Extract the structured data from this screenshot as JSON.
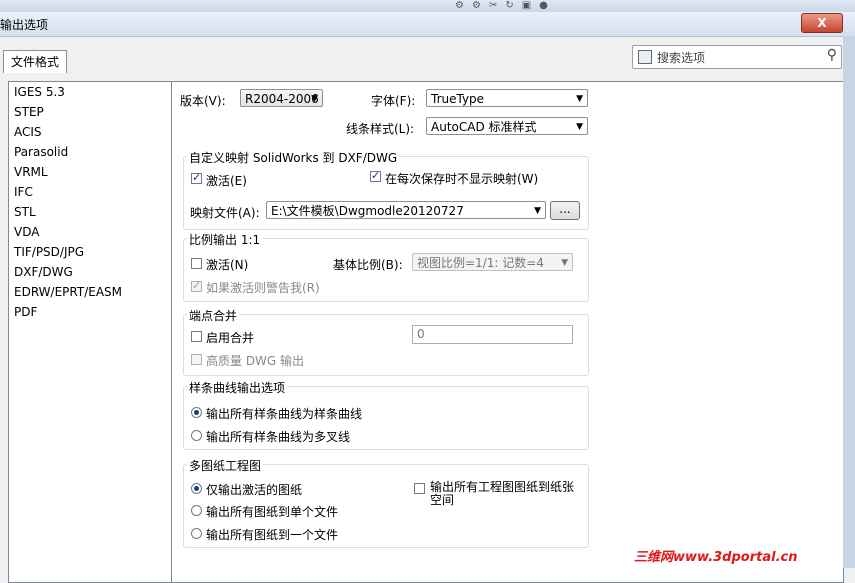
{
  "window": {
    "title": "输出选项",
    "close_label": "X"
  },
  "tab_label": "文件格式",
  "search": {
    "placeholder": "搜索选项"
  },
  "formats": [
    "IGES 5.3",
    "STEP",
    "ACIS",
    "Parasolid",
    "VRML",
    "IFC",
    "STL",
    "VDA",
    "TIF/PSD/JPG",
    "DXF/DWG",
    "EDRW/EPRT/EASM",
    "PDF"
  ],
  "selected_format": "DXF/DWG",
  "version": {
    "label": "版本(V):",
    "value": "R2004-2006"
  },
  "font": {
    "label": "字体(F):",
    "value": "TrueType"
  },
  "line_style": {
    "label": "线条样式(L):",
    "value": "AutoCAD 标准样式"
  },
  "custom_map": {
    "title": "自定义映射 SolidWorks 到 DXF/DWG",
    "activate_label": "激活(E)",
    "activate_checked": true,
    "no_show_label": "在每次保存时不显示映射(W)",
    "no_show_checked": true,
    "map_file_label": "映射文件(A):",
    "map_file_value": "E:\\文件模板\\Dwgmodle20120727",
    "browse_label": "..."
  },
  "scale_output": {
    "title": "比例输出 1:1",
    "activate_label": "激活(N)",
    "activate_checked": false,
    "base_scale_label": "基体比例(B):",
    "base_scale_value": "视图比例=1/1: 记数=4",
    "warn_label": "如果激活则警告我(R)",
    "warn_checked": true
  },
  "merge": {
    "title": "端点合并",
    "enable_label": "启用合并",
    "enable_checked": false,
    "tolerance_value": "0",
    "hq_label": "高质量 DWG 输出",
    "hq_checked": false
  },
  "spline": {
    "title": "样条曲线输出选项",
    "opt1": "输出所有样条曲线为样条曲线",
    "opt2": "输出所有样条曲线为多叉线",
    "selected": 1
  },
  "multisheet": {
    "title": "多图纸工程图",
    "opt1": "仅输出激活的图纸",
    "opt2": "输出所有图纸到单个文件",
    "opt3": "输出所有图纸到一个文件",
    "selected": 1,
    "paper_space_label_line1": "输出所有工程图图纸到纸张",
    "paper_space_label_line2": "空间",
    "paper_space_checked": false
  },
  "watermark": "三维网www.3dportal.cn"
}
